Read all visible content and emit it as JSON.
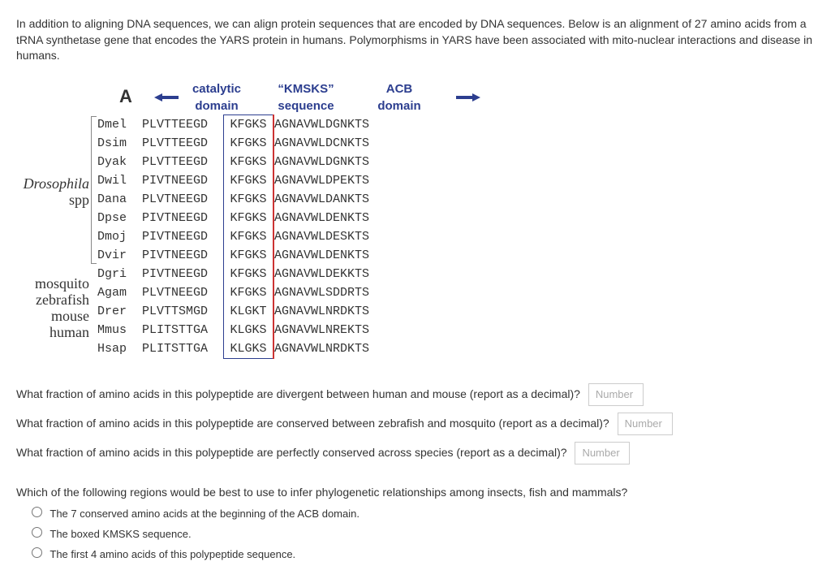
{
  "intro": "In addition to aligning DNA sequences, we can align protein sequences that are encoded by DNA sequences. Below is an alignment of 27 amino acids from a tRNA synthetase gene that encodes the YARS protein in humans. Polymorphisms in YARS have been associated with mito-nuclear interactions and disease in humans.",
  "panel_letter": "A",
  "headers": {
    "catalytic_l1": "catalytic",
    "catalytic_l2": "domain",
    "kmsks_l1": "“KMSKS”",
    "kmsks_l2": "sequence",
    "acb_l1": "ACB",
    "acb_l2": "domain"
  },
  "side_labels": {
    "drosophila": "Drosophila",
    "spp": "spp",
    "mosquito": "mosquito",
    "zebrafish": "zebrafish",
    "mouse": "mouse",
    "human": "human"
  },
  "rows": [
    {
      "code": "Dmel",
      "s1": "PLVTTEEGD",
      "s2": "KFGKS",
      "s3": "AGNAVWLDGNKTS"
    },
    {
      "code": "Dsim",
      "s1": "PLVTTEEGD",
      "s2": "KFGKS",
      "s3": "AGNAVWLDCNKTS"
    },
    {
      "code": "Dyak",
      "s1": "PLVTTEEGD",
      "s2": "KFGKS",
      "s3": "AGNAVWLDGNKTS"
    },
    {
      "code": "Dwil",
      "s1": "PIVTNEEGD",
      "s2": "KFGKS",
      "s3": "AGNAVWLDPEKTS"
    },
    {
      "code": "Dana",
      "s1": "PLVTNEEGD",
      "s2": "KFGKS",
      "s3": "AGNAVWLDANKTS"
    },
    {
      "code": "Dpse",
      "s1": "PIVTNEEGD",
      "s2": "KFGKS",
      "s3": "AGNAVWLDENKTS"
    },
    {
      "code": "Dmoj",
      "s1": "PIVTNEEGD",
      "s2": "KFGKS",
      "s3": "AGNAVWLDESKTS"
    },
    {
      "code": "Dvir",
      "s1": "PIVTNEEGD",
      "s2": "KFGKS",
      "s3": "AGNAVWLDENKTS"
    },
    {
      "code": "Dgri",
      "s1": "PIVTNEEGD",
      "s2": "KFGKS",
      "s3": "AGNAVWLDEKKTS"
    },
    {
      "code": "Agam",
      "s1": "PLVTNEEGD",
      "s2": "KFGKS",
      "s3": "AGNAVWLSDDRTS"
    },
    {
      "code": "Drer",
      "s1": "PLVTTSMGD",
      "s2": "KLGKT",
      "s3": "AGNAVWLNRDKTS"
    },
    {
      "code": "Mmus",
      "s1": "PLITSTTGA",
      "s2": "KLGKS",
      "s3": "AGNAVWLNREKTS"
    },
    {
      "code": "Hsap",
      "s1": "PLITSTTGA",
      "s2": "KLGKS",
      "s3": "AGNAVWLNRDKTS"
    }
  ],
  "q1": "What fraction of amino acids in this polypeptide are divergent between human and mouse (report as a decimal)?",
  "q2": "What fraction of amino acids in this polypeptide are conserved between zebrafish and mosquito (report as a decimal)?",
  "q3": "What fraction of amino acids in this polypeptide are perfectly conserved across species (report as a decimal)?",
  "mc_prompt": "Which of the following regions would be best to use to infer phylogenetic relationships among insects, fish and mammals?",
  "mc_options": {
    "a": "The 7 conserved amino acids at the beginning of the ACB domain.",
    "b": "The boxed KMSKS sequence.",
    "c": "The first 4 amino acids of this polypeptide sequence."
  },
  "placeholder": "Number"
}
